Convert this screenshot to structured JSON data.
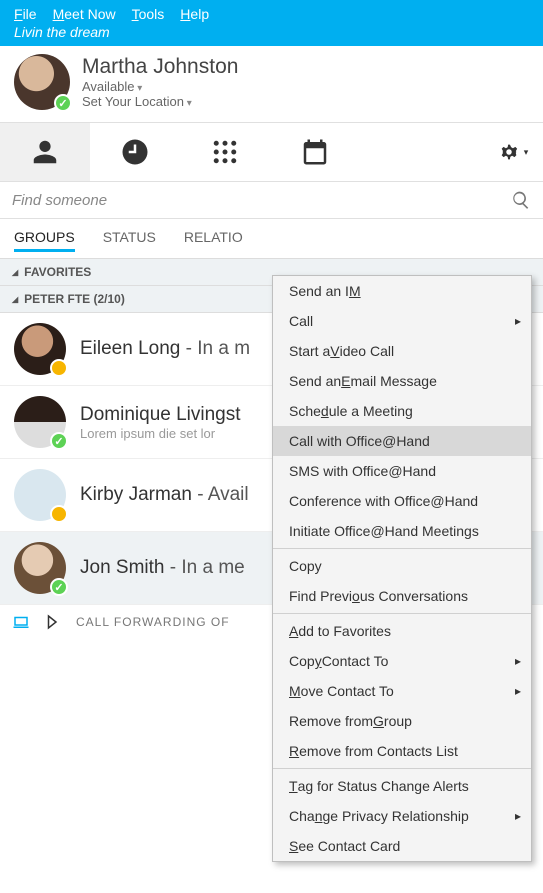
{
  "menubar": {
    "file": "File",
    "meet": "Meet Now",
    "tools": "Tools",
    "help": "Help"
  },
  "tagline": "Livin the dream",
  "user": {
    "name": "Martha Johnston",
    "status": "Available",
    "location": "Set Your Location"
  },
  "search": {
    "placeholder": "Find someone"
  },
  "filters": {
    "groups": "GROUPS",
    "status": "STATUS",
    "relations": "RELATIO"
  },
  "groups": {
    "favorites": "FAVORITES",
    "grp1": "PETER FTE (2/10)"
  },
  "contacts": [
    {
      "name": "Eileen Long",
      "status": " - In a m",
      "sub": ""
    },
    {
      "name": "Dominique Livingst",
      "status": "",
      "sub": "Lorem ipsum die set lor"
    },
    {
      "name": "Kirby Jarman",
      "status": " - Avail",
      "sub": ""
    },
    {
      "name": "Jon Smith",
      "status": " - In a me",
      "sub": ""
    }
  ],
  "bottom": {
    "text": "CALL FORWARDING OF"
  },
  "context": {
    "send_im": "Send an IM",
    "call": "Call",
    "video": "Start a Video Call",
    "email": "Send an Email Message",
    "schedule": "Schedule a Meeting",
    "call_oh": "Call with Office@Hand",
    "sms_oh": "SMS with Office@Hand",
    "conf_oh": "Conference with Office@Hand",
    "init_oh": "Initiate Office@Hand Meetings",
    "copy": "Copy",
    "find_prev": "Find Previous Conversations",
    "add_fav": "Add to Favorites",
    "copy_to": "Copy Contact To",
    "move_to": "Move Contact To",
    "rem_grp": "Remove from Group",
    "rem_list": "Remove from Contacts List",
    "tag": "Tag for Status Change Alerts",
    "privacy": "Change Privacy Relationship",
    "card": "See Contact Card"
  }
}
